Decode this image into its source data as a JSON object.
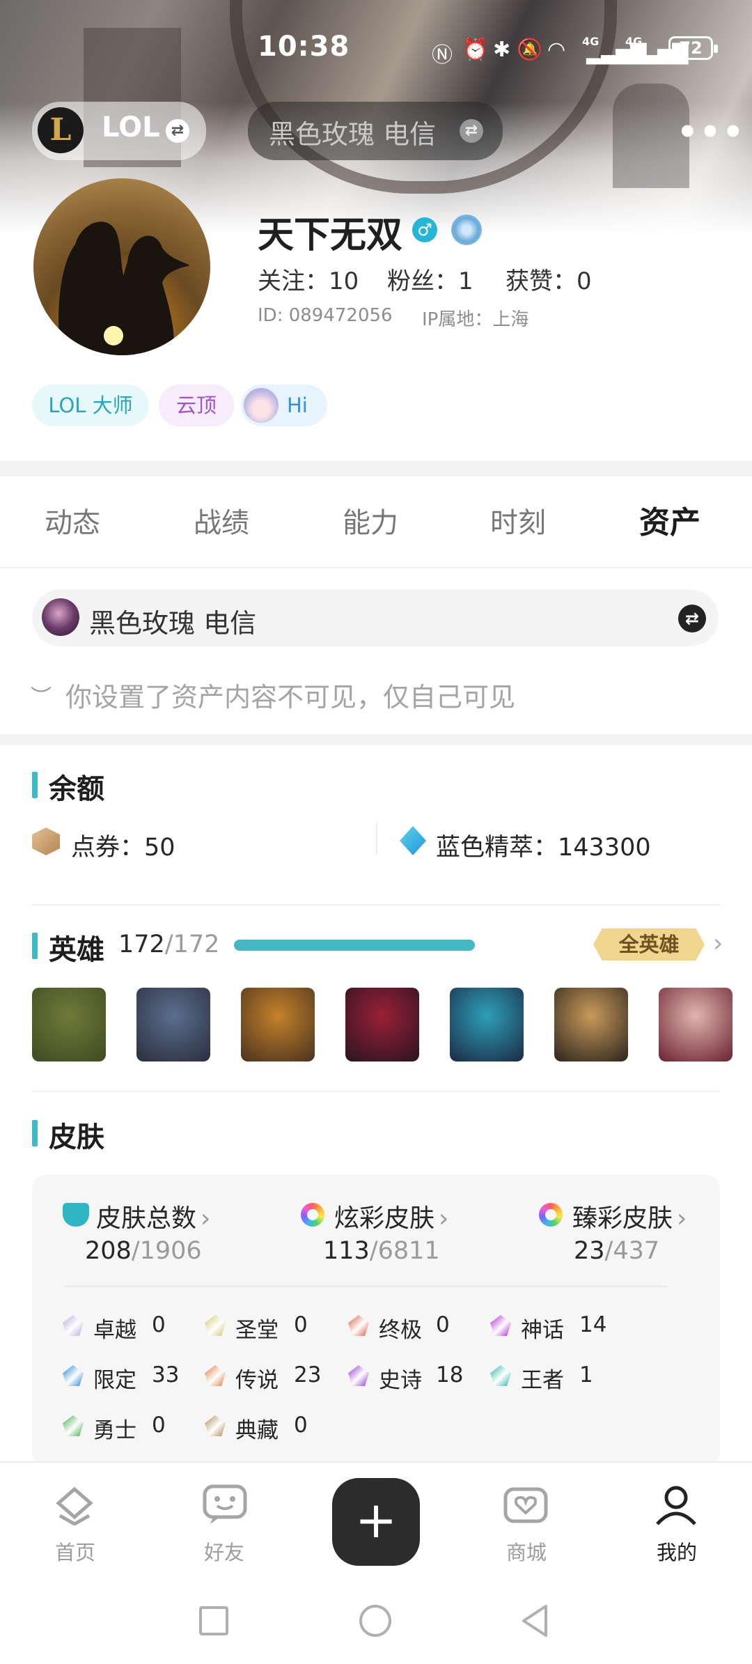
{
  "status_bar": {
    "time": "10:38",
    "network": "4G",
    "battery": "72",
    "icons": [
      "nfc-icon",
      "alarm-icon",
      "bluetooth-icon",
      "mute-icon",
      "wifi-icon",
      "signal-icon",
      "signal-icon"
    ]
  },
  "header": {
    "game": "LOL",
    "server": "黑色玫瑰 电信",
    "more": "•••"
  },
  "profile": {
    "name": "天下无双",
    "follow_label": "关注：",
    "follow_value": "10",
    "fans_label": "粉丝：",
    "fans_value": "1",
    "likes_label": "获赞：",
    "likes_value": "0",
    "id_text": "ID:   089472056",
    "ip_text": "IP属地：上海",
    "tags": [
      "LOL 大师",
      "云顶",
      "Hi"
    ]
  },
  "tabs": [
    "动态",
    "战绩",
    "能力",
    "时刻",
    "资产"
  ],
  "account_bar": {
    "label": "黑色玫瑰 电信"
  },
  "privacy_note": "你设置了资产内容不可见，仅自己可见",
  "balance": {
    "title": "余额",
    "coupon_label": "点券：",
    "coupon_value": "50",
    "essence_label": "蓝色精萃：",
    "essence_value": "143300"
  },
  "heroes": {
    "title": "英雄",
    "owned": "172",
    "total": "/172",
    "progress": 1.0,
    "all_button": "全英雄",
    "avatars": [
      {
        "name": "champion-1",
        "colors": [
          "#6f7a3a",
          "#3f4a22"
        ]
      },
      {
        "name": "champion-2",
        "colors": [
          "#5b6f8e",
          "#2a2e3d"
        ]
      },
      {
        "name": "champion-3",
        "colors": [
          "#c4822a",
          "#4a3220"
        ]
      },
      {
        "name": "champion-4",
        "colors": [
          "#9a2036",
          "#2a1422"
        ]
      },
      {
        "name": "champion-5",
        "colors": [
          "#2e9fb8",
          "#1b2a44"
        ]
      },
      {
        "name": "champion-6",
        "colors": [
          "#c99a5a",
          "#2b241e"
        ]
      },
      {
        "name": "champion-7",
        "colors": [
          "#e0b5b0",
          "#6a2230"
        ]
      }
    ]
  },
  "skins": {
    "title": "皮肤",
    "total_label": "皮肤总数",
    "total_owned": "208",
    "total_all": "/1906",
    "chroma_label": "炫彩皮肤",
    "chroma_owned": "113",
    "chroma_all": "/6811",
    "prestige_label": "臻彩皮肤",
    "prestige_owned": "23",
    "prestige_all": "/437",
    "tiers": [
      {
        "label": "卓越",
        "value": "0",
        "color": "#b7a6d8"
      },
      {
        "label": "圣堂",
        "value": "0",
        "color": "#d4c36b"
      },
      {
        "label": "终极",
        "value": "0",
        "color": "#d8583d"
      },
      {
        "label": "神话",
        "value": "14",
        "color": "#b21fd1"
      },
      {
        "label": "限定",
        "value": "33",
        "color": "#1f7fd0"
      },
      {
        "label": "传说",
        "value": "23",
        "color": "#e0733a"
      },
      {
        "label": "史诗",
        "value": "18",
        "color": "#8f2ec9"
      },
      {
        "label": "王者",
        "value": "1",
        "color": "#27b3a3"
      },
      {
        "label": "勇士",
        "value": "0",
        "color": "#39a845"
      },
      {
        "label": "典藏",
        "value": "0",
        "color": "#a9864a"
      }
    ]
  },
  "bottom_nav": {
    "home": "首页",
    "friends": "好友",
    "add": "+",
    "mall": "商城",
    "mine": "我的"
  }
}
